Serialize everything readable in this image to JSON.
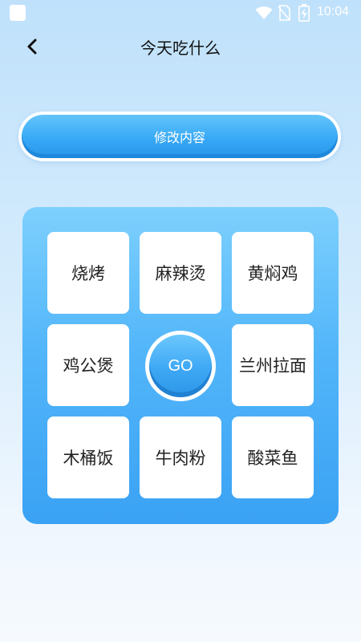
{
  "status_bar": {
    "time": "10:04",
    "icons": [
      "notification-square-icon",
      "wifi-icon",
      "no-sim-icon",
      "battery-charging-icon"
    ]
  },
  "header": {
    "title": "今天吃什么",
    "back_icon": "chevron-left-icon"
  },
  "edit_button": {
    "label": "修改内容"
  },
  "grid": {
    "items": [
      "烧烤",
      "麻辣烫",
      "黄焖鸡",
      "鸡公煲",
      "兰州拉面",
      "木桶饭",
      "牛肉粉",
      "酸菜鱼"
    ],
    "go_label": "GO"
  },
  "colors": {
    "accent": "#3aa2f4",
    "panel_top": "#7dd0fd",
    "background_top": "#bfe1fb"
  }
}
